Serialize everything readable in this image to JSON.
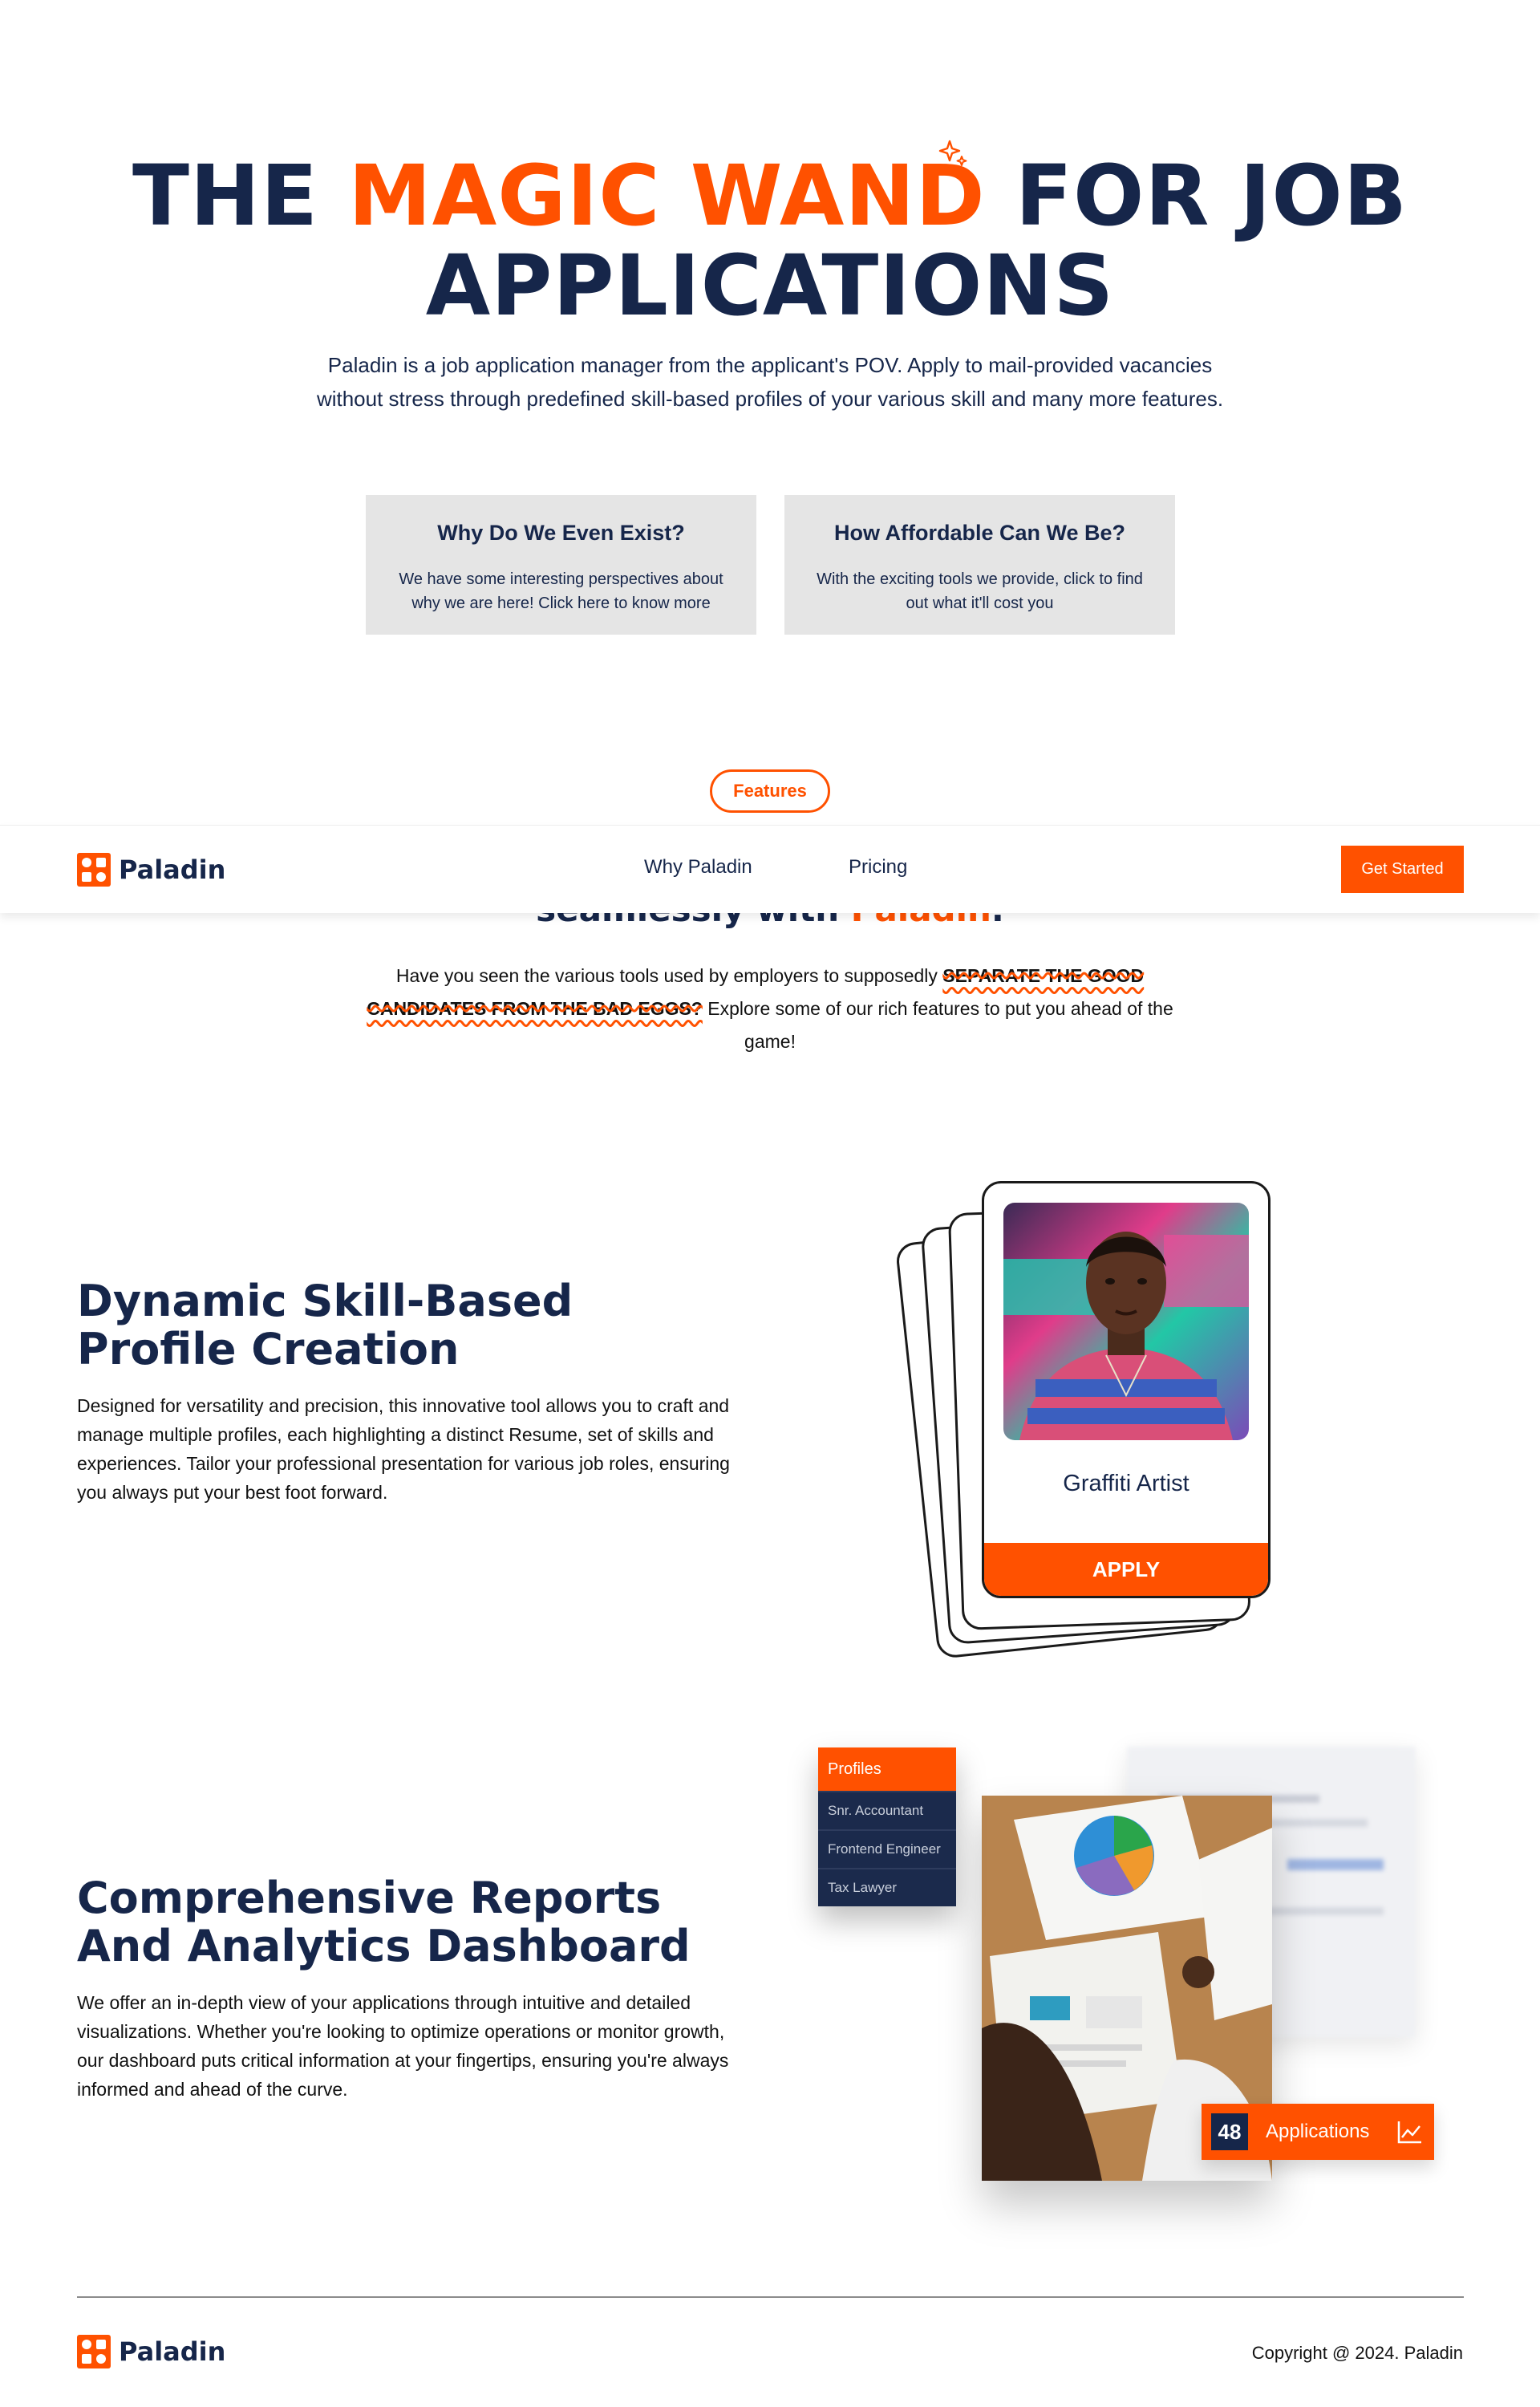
{
  "hero": {
    "title_part1": "THE ",
    "title_accent": "MAGIC WAND",
    "title_part2": " FOR JOB APPLICATIONS",
    "subtitle": "Paladin is a job application manager from the applicant's POV. Apply to mail-provided vacancies without stress through predefined skill-based profiles of your various skill and many more features.",
    "cards": [
      {
        "title": "Why Do We Even Exist?",
        "text": "We have some interesting perspectives about why we are here! Click here to know more"
      },
      {
        "title": "How Affordable Can We Be?",
        "text": "With the exciting tools we provide, click to find out what it'll cost you"
      }
    ]
  },
  "features_pill": "Features",
  "hidden_heading": {
    "part1": "seamlessly with ",
    "accent": "Paladin",
    "part2": "."
  },
  "navbar": {
    "logo_text": "Paladin",
    "links": [
      "Why Paladin",
      "Pricing"
    ],
    "cta": "Get Started"
  },
  "intro": {
    "before": "Have you seen the various tools used by employers to supposedly ",
    "highlight": "SEPARATE THE GOOD CANDIDATES FROM THE BAD EGGS?",
    "after": " Explore some of our rich features to put you ahead of the game!"
  },
  "feature1": {
    "title": "Dynamic Skill-Based Profile Creation",
    "text": "Designed for versatility and precision, this innovative tool allows you to craft and manage multiple profiles, each highlighting a distinct Resume, set of skills and experiences. Tailor your professional presentation for various job roles, ensuring you always put your best foot forward.",
    "card_role": "Graffiti Artist",
    "card_button": "APPLY"
  },
  "feature2": {
    "title": "Comprehensive Reports And Analytics Dashboard",
    "text": "We offer an in-depth view of your applications through intuitive and detailed visualizations. Whether you're looking to optimize operations or monitor growth, our dashboard puts critical information at your fingertips, ensuring you're always informed and ahead of the curve.",
    "menu_header": "Profiles",
    "menu_items": [
      "Snr. Accountant",
      "Frontend Engineer",
      "Tax Lawyer"
    ],
    "badge_count": "48",
    "badge_label": "Applications"
  },
  "footer": {
    "logo_text": "Paladin",
    "copyright": "Copyright @ 2024. Paladin"
  },
  "colors": {
    "navy": "#16264a",
    "orange": "#ff5100",
    "card_bg": "#e5e5e5"
  }
}
